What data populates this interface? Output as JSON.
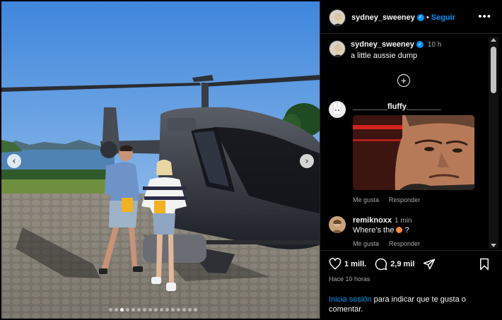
{
  "post": {
    "username": "sydney_sweeney",
    "separator": "•",
    "follow_label": "Seguir",
    "more_label": "•••",
    "caption_text": "a little aussie dump",
    "caption_time": "10 h",
    "carousel": {
      "prev_icon": "chevron-left-icon",
      "next_icon": "chevron-right-icon",
      "slide_count": 16,
      "active_index": 2
    }
  },
  "comments": [
    {
      "username": "________fluffy________",
      "time": "",
      "body": "",
      "actions": {
        "like": "Me gusta",
        "reply": "Responder"
      }
    },
    {
      "username": "remiknoxx",
      "time": "1 min",
      "body_prefix": "Where's the",
      "body_suffix": "?",
      "actions": {
        "like": "Me gusta",
        "reply": "Responder"
      }
    }
  ],
  "stats": {
    "likes": "1 mill.",
    "comments": "2,9 mil",
    "time_ago": "Hace 10 horas"
  },
  "login_prompt": {
    "link": "Inicia sesión",
    "text": " para indicar que te gusta o comentar."
  },
  "colors": {
    "background": "#000000",
    "accent": "#0095f6",
    "muted_text": "#a8a8a8",
    "divider": "#262626"
  }
}
